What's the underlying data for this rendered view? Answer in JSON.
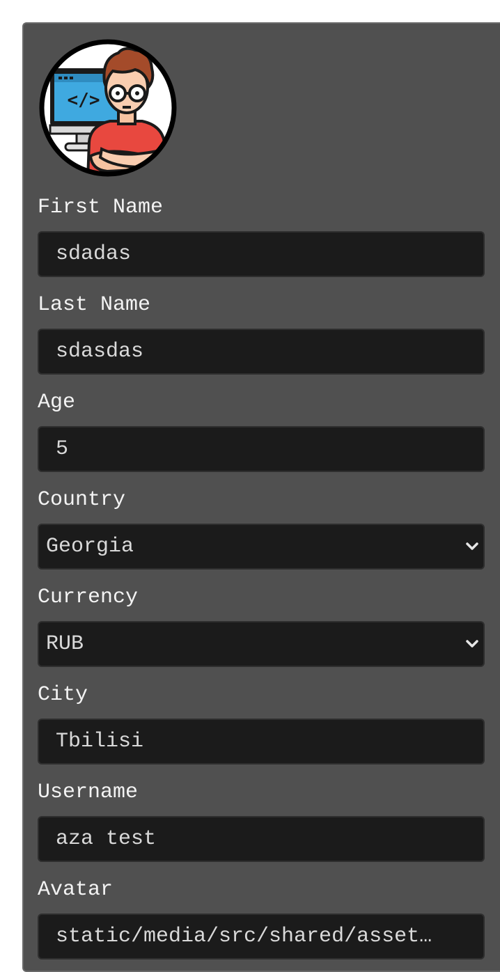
{
  "profile": {
    "avatar_icon": "developer-avatar-icon",
    "fields": {
      "first_name": {
        "label": "First Name",
        "value": "sdadas"
      },
      "last_name": {
        "label": "Last Name",
        "value": "sdasdas"
      },
      "age": {
        "label": "Age",
        "value": "5"
      },
      "country": {
        "label": "Country",
        "selected": "Georgia"
      },
      "currency": {
        "label": "Currency",
        "selected": "RUB"
      },
      "city": {
        "label": "City",
        "value": "Tbilisi"
      },
      "username": {
        "label": "Username",
        "value": "aza test"
      },
      "avatar": {
        "label": "Avatar",
        "value": "static/media/src/shared/asset…"
      }
    }
  },
  "colors": {
    "card_background": "#505050",
    "input_background": "#1b1b1b",
    "label_text": "#f3f3f3",
    "input_text": "#d9d9d9"
  }
}
